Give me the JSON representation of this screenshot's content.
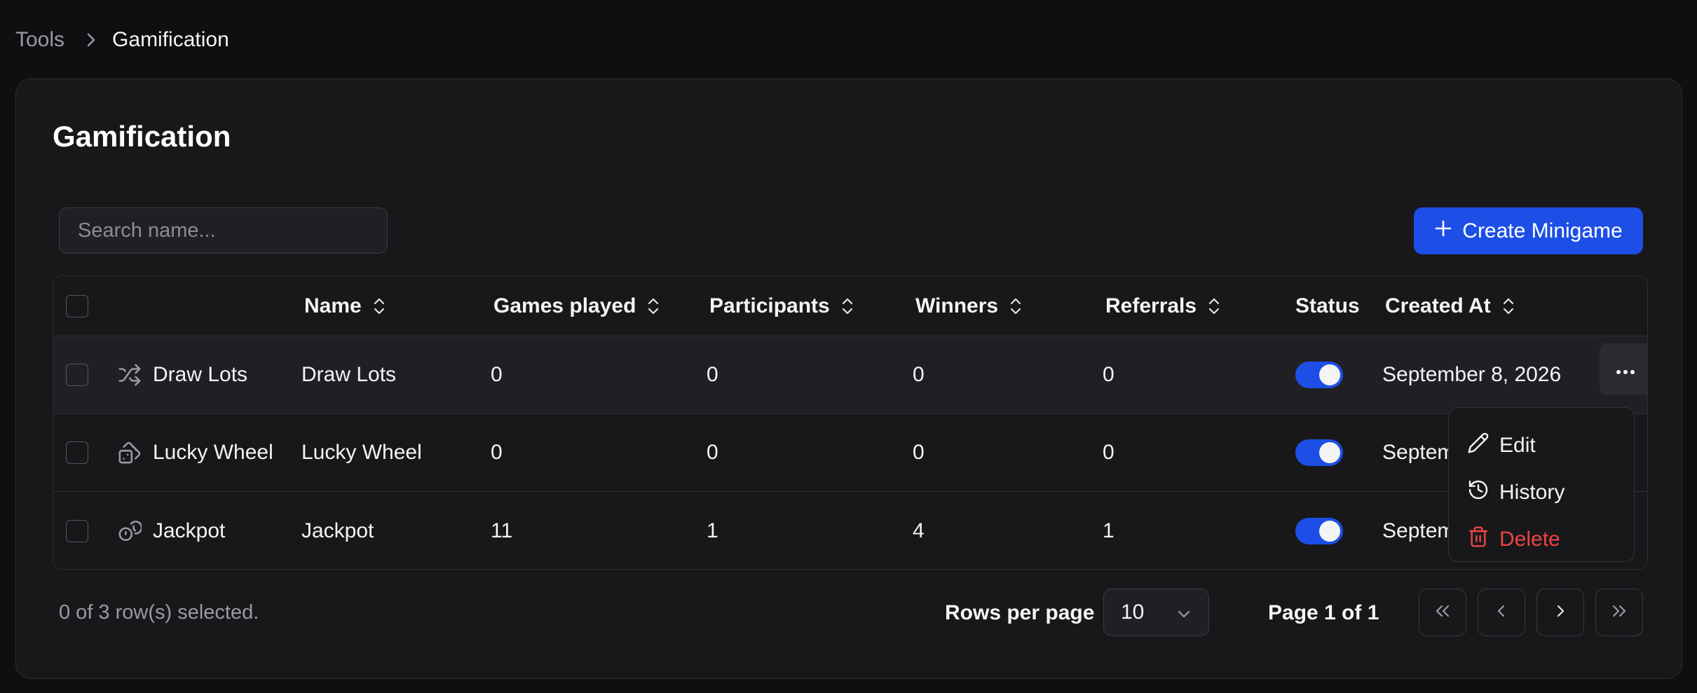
{
  "breadcrumb": {
    "parent": "Tools",
    "current": "Gamification"
  },
  "page": {
    "title": "Gamification"
  },
  "search": {
    "placeholder": "Search name..."
  },
  "create_button": {
    "label": "Create Minigame"
  },
  "columns": {
    "name": "Name",
    "games_played": "Games played",
    "participants": "Participants",
    "winners": "Winners",
    "referrals": "Referrals",
    "status": "Status",
    "created_at": "Created At"
  },
  "rows": [
    {
      "type_label": "Draw Lots",
      "type_icon": "shuffle-icon",
      "name": "Draw Lots",
      "games_played": "0",
      "participants": "0",
      "winners": "0",
      "referrals": "0",
      "status_on": true,
      "created_at": "September 8, 2026"
    },
    {
      "type_label": "Lucky Wheel",
      "type_icon": "dice-icon",
      "name": "Lucky Wheel",
      "games_played": "0",
      "participants": "0",
      "winners": "0",
      "referrals": "0",
      "status_on": true,
      "created_at": "Septemb"
    },
    {
      "type_label": "Jackpot",
      "type_icon": "coins-icon",
      "name": "Jackpot",
      "games_played": "11",
      "participants": "1",
      "winners": "4",
      "referrals": "1",
      "status_on": true,
      "created_at": "Septemb"
    }
  ],
  "row_menu": {
    "edit": "Edit",
    "history": "History",
    "delete": "Delete"
  },
  "footer": {
    "selected_text": "0 of 3 row(s) selected.",
    "rows_per_page_label": "Rows per page",
    "rows_per_page_value": "10",
    "page_text": "Page 1 of 1"
  },
  "colors": {
    "accent": "#1d4fe6",
    "danger": "#ef4444",
    "background": "#0f0f12",
    "card": "#18181b"
  }
}
